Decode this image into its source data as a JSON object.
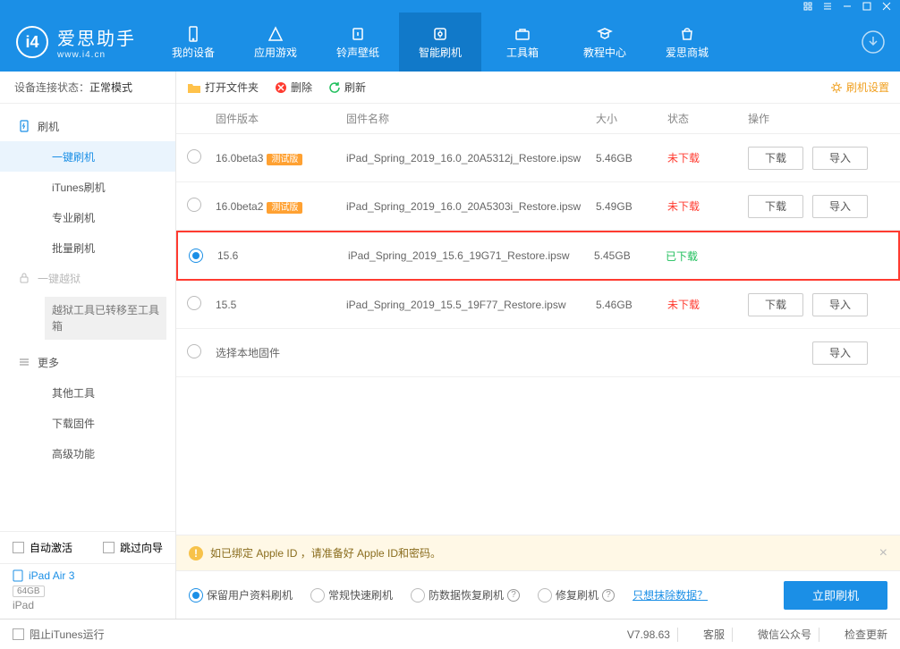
{
  "app": {
    "name": "爱思助手",
    "url": "www.i4.cn"
  },
  "nav": {
    "items": [
      {
        "label": "我的设备"
      },
      {
        "label": "应用游戏"
      },
      {
        "label": "铃声壁纸"
      },
      {
        "label": "智能刷机"
      },
      {
        "label": "工具箱"
      },
      {
        "label": "教程中心"
      },
      {
        "label": "爱思商城"
      }
    ]
  },
  "sidebar": {
    "status_label": "设备连接状态：",
    "status_value": "正常模式",
    "section_flash": "刷机",
    "items": {
      "one_click": "一键刷机",
      "itunes": "iTunes刷机",
      "pro": "专业刷机",
      "batch": "批量刷机"
    },
    "section_jailbreak": "一键越狱",
    "jailbreak_note": "越狱工具已转移至工具箱",
    "section_more": "更多",
    "more": {
      "other_tools": "其他工具",
      "download_fw": "下载固件",
      "advanced": "高级功能"
    },
    "auto_activate": "自动激活",
    "skip_wizard": "跳过向导",
    "device": {
      "name": "iPad Air 3",
      "capacity": "64GB",
      "type": "iPad"
    }
  },
  "toolbar": {
    "open_folder": "打开文件夹",
    "delete": "删除",
    "refresh": "刷新",
    "settings": "刷机设置"
  },
  "table": {
    "headers": {
      "version": "固件版本",
      "name": "固件名称",
      "size": "大小",
      "status": "状态",
      "ops": "操作"
    },
    "rows": [
      {
        "version": "16.0beta3",
        "beta": "测试版",
        "name": "iPad_Spring_2019_16.0_20A5312j_Restore.ipsw",
        "size": "5.46GB",
        "status": "未下载",
        "status_class": "red"
      },
      {
        "version": "16.0beta2",
        "beta": "测试版",
        "name": "iPad_Spring_2019_16.0_20A5303i_Restore.ipsw",
        "size": "5.49GB",
        "status": "未下载",
        "status_class": "red"
      },
      {
        "version": "15.6",
        "name": "iPad_Spring_2019_15.6_19G71_Restore.ipsw",
        "size": "5.45GB",
        "status": "已下载",
        "status_class": "green",
        "selected": true
      },
      {
        "version": "15.5",
        "name": "iPad_Spring_2019_15.5_19F77_Restore.ipsw",
        "size": "5.46GB",
        "status": "未下载",
        "status_class": "red"
      }
    ],
    "select_local": "选择本地固件",
    "btn_download": "下载",
    "btn_import": "导入"
  },
  "info": {
    "text": "如已绑定 Apple ID ，请准备好 Apple ID和密码。"
  },
  "actions": {
    "keep_data": "保留用户资料刷机",
    "normal_fast": "常规快速刷机",
    "anti_data": "防数据恢复刷机",
    "repair": "修复刷机",
    "link": "只想抹除数据？",
    "flash_now": "立即刷机"
  },
  "footer": {
    "block_itunes": "阻止iTunes运行",
    "version": "V7.98.63",
    "support": "客服",
    "wechat": "微信公众号",
    "check_update": "检查更新"
  }
}
